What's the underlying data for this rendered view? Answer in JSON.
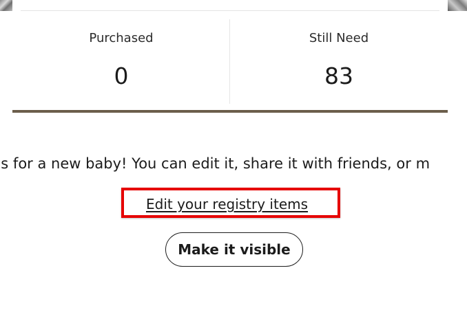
{
  "stats": {
    "purchased": {
      "label": "Purchased",
      "value": "0"
    },
    "still_need": {
      "label": "Still Need",
      "value": "83"
    }
  },
  "intro_text": "ns for a new baby! You can edit it, share it with friends, or m",
  "actions": {
    "edit_link": "Edit your registry items",
    "make_visible": "Make it visible"
  },
  "colors": {
    "accent_rule": "#6b5e4b",
    "highlight_box": "#e60000",
    "text": "#1b1b1b"
  }
}
